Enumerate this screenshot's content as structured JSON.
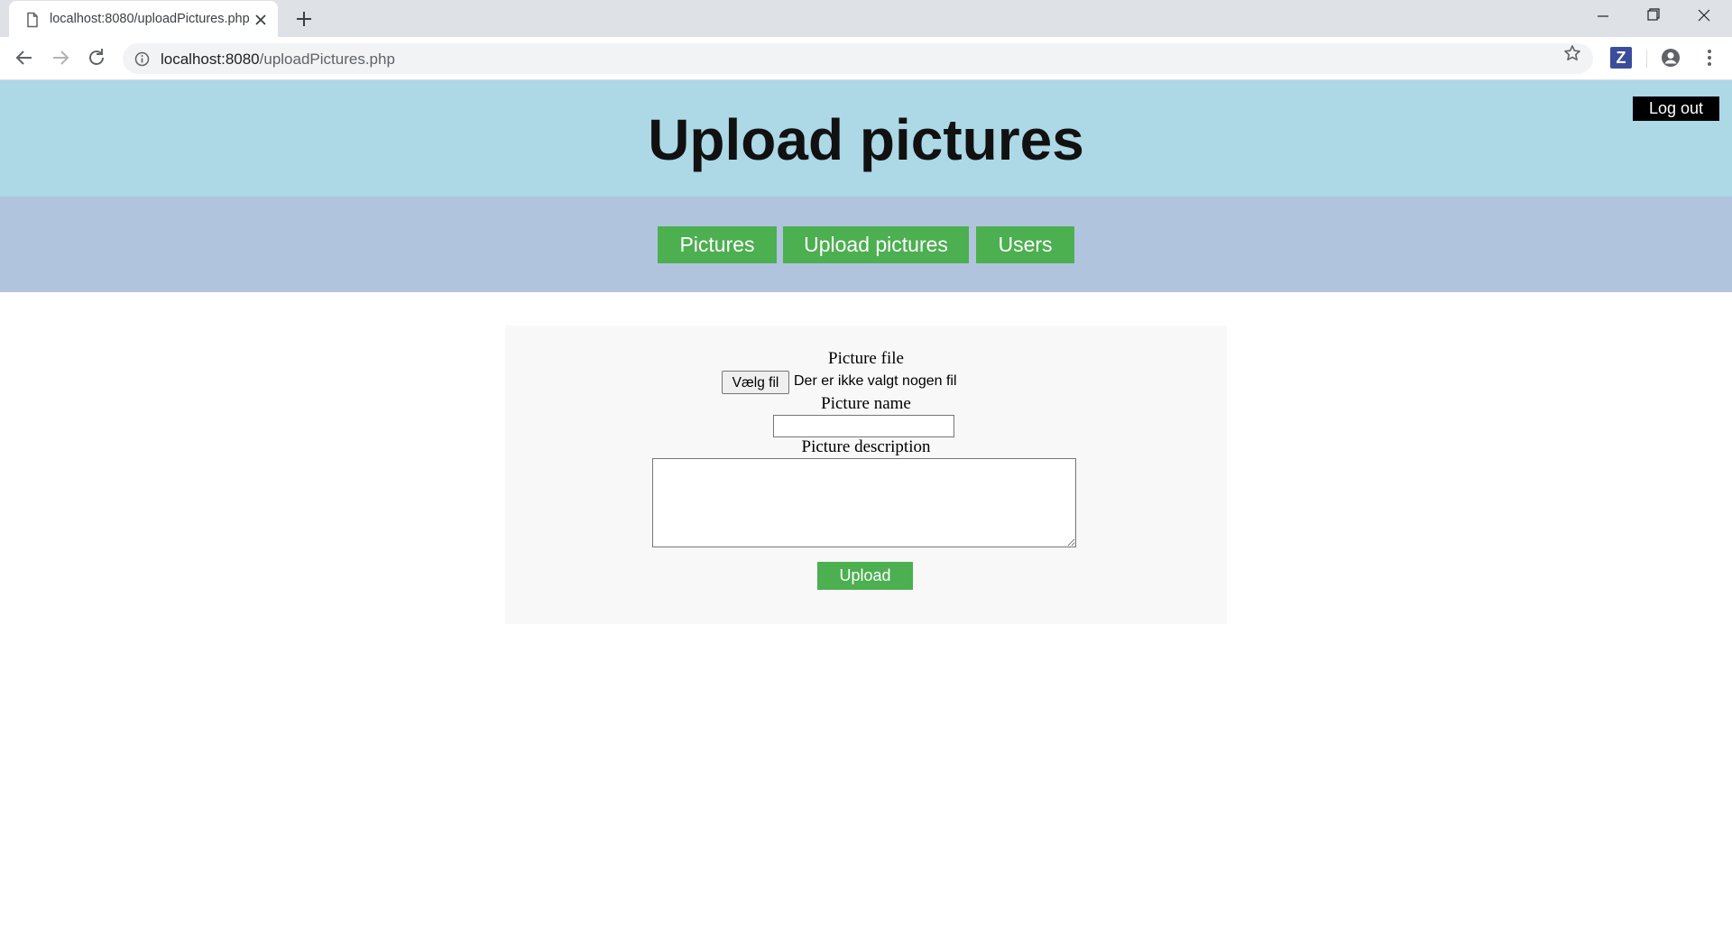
{
  "browser": {
    "tab_title": "localhost:8080/uploadPictures.php",
    "url_host": "localhost:8080",
    "url_path": "/uploadPictures.php",
    "icons": {
      "tab": "page-icon",
      "close": "close-icon",
      "new_tab": "plus-icon",
      "back": "back-arrow-icon",
      "forward": "forward-arrow-icon",
      "reload": "reload-icon",
      "info": "info-icon",
      "bookmark": "star-icon",
      "extension": "zotero-extension-icon",
      "extension_letter": "Z",
      "profile": "profile-icon",
      "menu": "kebab-menu-icon",
      "minimize": "minimize-icon",
      "restore": "restore-icon",
      "window_close": "window-close-icon"
    }
  },
  "header": {
    "title": "Upload pictures",
    "logout_label": "Log out"
  },
  "nav": {
    "items": [
      {
        "label": "Pictures"
      },
      {
        "label": "Upload pictures"
      },
      {
        "label": "Users"
      }
    ]
  },
  "form": {
    "file_label": "Picture file",
    "file_button": "Vælg fil",
    "file_status": "Der er ikke valgt nogen fil",
    "name_label": "Picture name",
    "name_value": "",
    "description_label": "Picture description",
    "description_value": "",
    "submit_label": "Upload"
  },
  "colors": {
    "header_bg": "#add8e6",
    "nav_bg": "#b0c4de",
    "button_green": "#4caf50",
    "form_bg": "#f8f8f8",
    "logout_bg": "#000000"
  }
}
